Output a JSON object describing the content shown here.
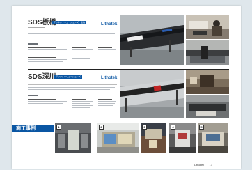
{
  "section1": {
    "title": "SDS板橋",
    "tag": "デジタルソリューションズ　板橋",
    "brand": "Lithotek"
  },
  "section2": {
    "title": "SDS深川",
    "tag": "デジタルソリューションズ",
    "brand": "Lithotek"
  },
  "cases": {
    "title": "施工事例",
    "items": [
      {
        "num": "1"
      },
      {
        "num": "2"
      },
      {
        "num": "3"
      },
      {
        "num": "4"
      },
      {
        "num": "5"
      }
    ]
  },
  "footer": {
    "logo": "Lithotek",
    "page": "13"
  },
  "colors": {
    "accent": "#0a56a3"
  }
}
